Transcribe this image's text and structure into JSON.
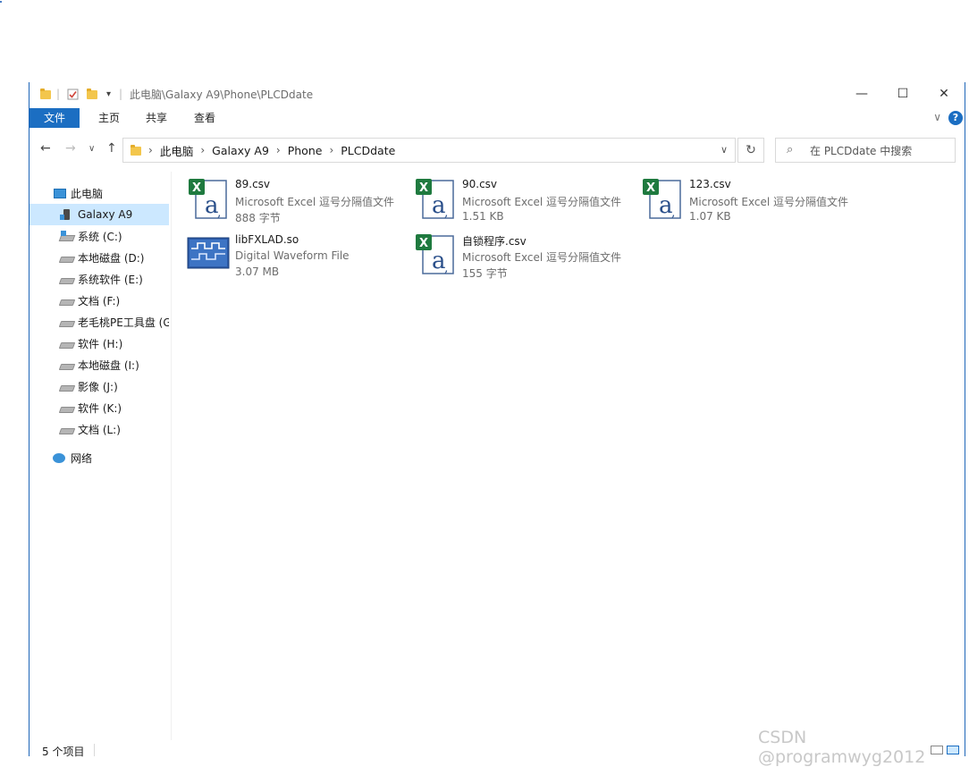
{
  "window": {
    "title": "此电脑\\Galaxy A9\\Phone\\PLCDdate",
    "controls": {
      "minimize": "—",
      "maximize": "☐",
      "close": "✕"
    }
  },
  "ribbon": {
    "tabs": [
      {
        "label": "文件"
      },
      {
        "label": "主页"
      },
      {
        "label": "共享"
      },
      {
        "label": "查看"
      }
    ],
    "collapse": "∨",
    "help": "?"
  },
  "nav": {
    "back": "←",
    "forward": "→",
    "recent": "∨",
    "up": "↑",
    "breadcrumb": [
      "此电脑",
      "Galaxy A9",
      "Phone",
      "PLCDdate"
    ],
    "address_dropdown": "∨",
    "refresh": "↻",
    "search_placeholder": "在 PLCDdate 中搜索"
  },
  "sidebar": {
    "items": [
      {
        "label": "此电脑",
        "icon": "pc-icon"
      },
      {
        "label": "Galaxy A9",
        "icon": "phone-icon",
        "selected": true
      },
      {
        "label": "系统 (C:)",
        "icon": "system-drive-icon"
      },
      {
        "label": "本地磁盘 (D:)",
        "icon": "drive-icon"
      },
      {
        "label": "系统软件 (E:)",
        "icon": "drive-icon"
      },
      {
        "label": "文档 (F:)",
        "icon": "drive-icon"
      },
      {
        "label": "老毛桃PE工具盘 (G",
        "icon": "drive-icon"
      },
      {
        "label": "软件 (H:)",
        "icon": "drive-icon"
      },
      {
        "label": "本地磁盘 (I:)",
        "icon": "drive-icon"
      },
      {
        "label": "影像 (J:)",
        "icon": "drive-icon"
      },
      {
        "label": "软件 (K:)",
        "icon": "drive-icon"
      },
      {
        "label": "文档 (L:)",
        "icon": "drive-icon"
      },
      {
        "label": "网络",
        "icon": "network-icon"
      }
    ]
  },
  "files": [
    {
      "name": "89.csv",
      "type": "Microsoft Excel 逗号分隔值文件",
      "size": "888 字节",
      "icon": "excel-csv-icon"
    },
    {
      "name": "90.csv",
      "type": "Microsoft Excel 逗号分隔值文件",
      "size": "1.51 KB",
      "icon": "excel-csv-icon"
    },
    {
      "name": "123.csv",
      "type": "Microsoft Excel 逗号分隔值文件",
      "size": "1.07 KB",
      "icon": "excel-csv-icon"
    },
    {
      "name": "libFXLAD.so",
      "type": "Digital Waveform File",
      "size": "3.07 MB",
      "icon": "waveform-file-icon"
    },
    {
      "name": "自锁程序.csv",
      "type": "Microsoft Excel 逗号分隔值文件",
      "size": "155 字节",
      "icon": "excel-csv-icon"
    }
  ],
  "status": {
    "count": "5 个项目"
  },
  "watermark": "CSDN @programwyg2012",
  "colors": {
    "accent": "#1b6ec2",
    "selection": "#cce8ff",
    "excel_green": "#1f7a3f"
  }
}
